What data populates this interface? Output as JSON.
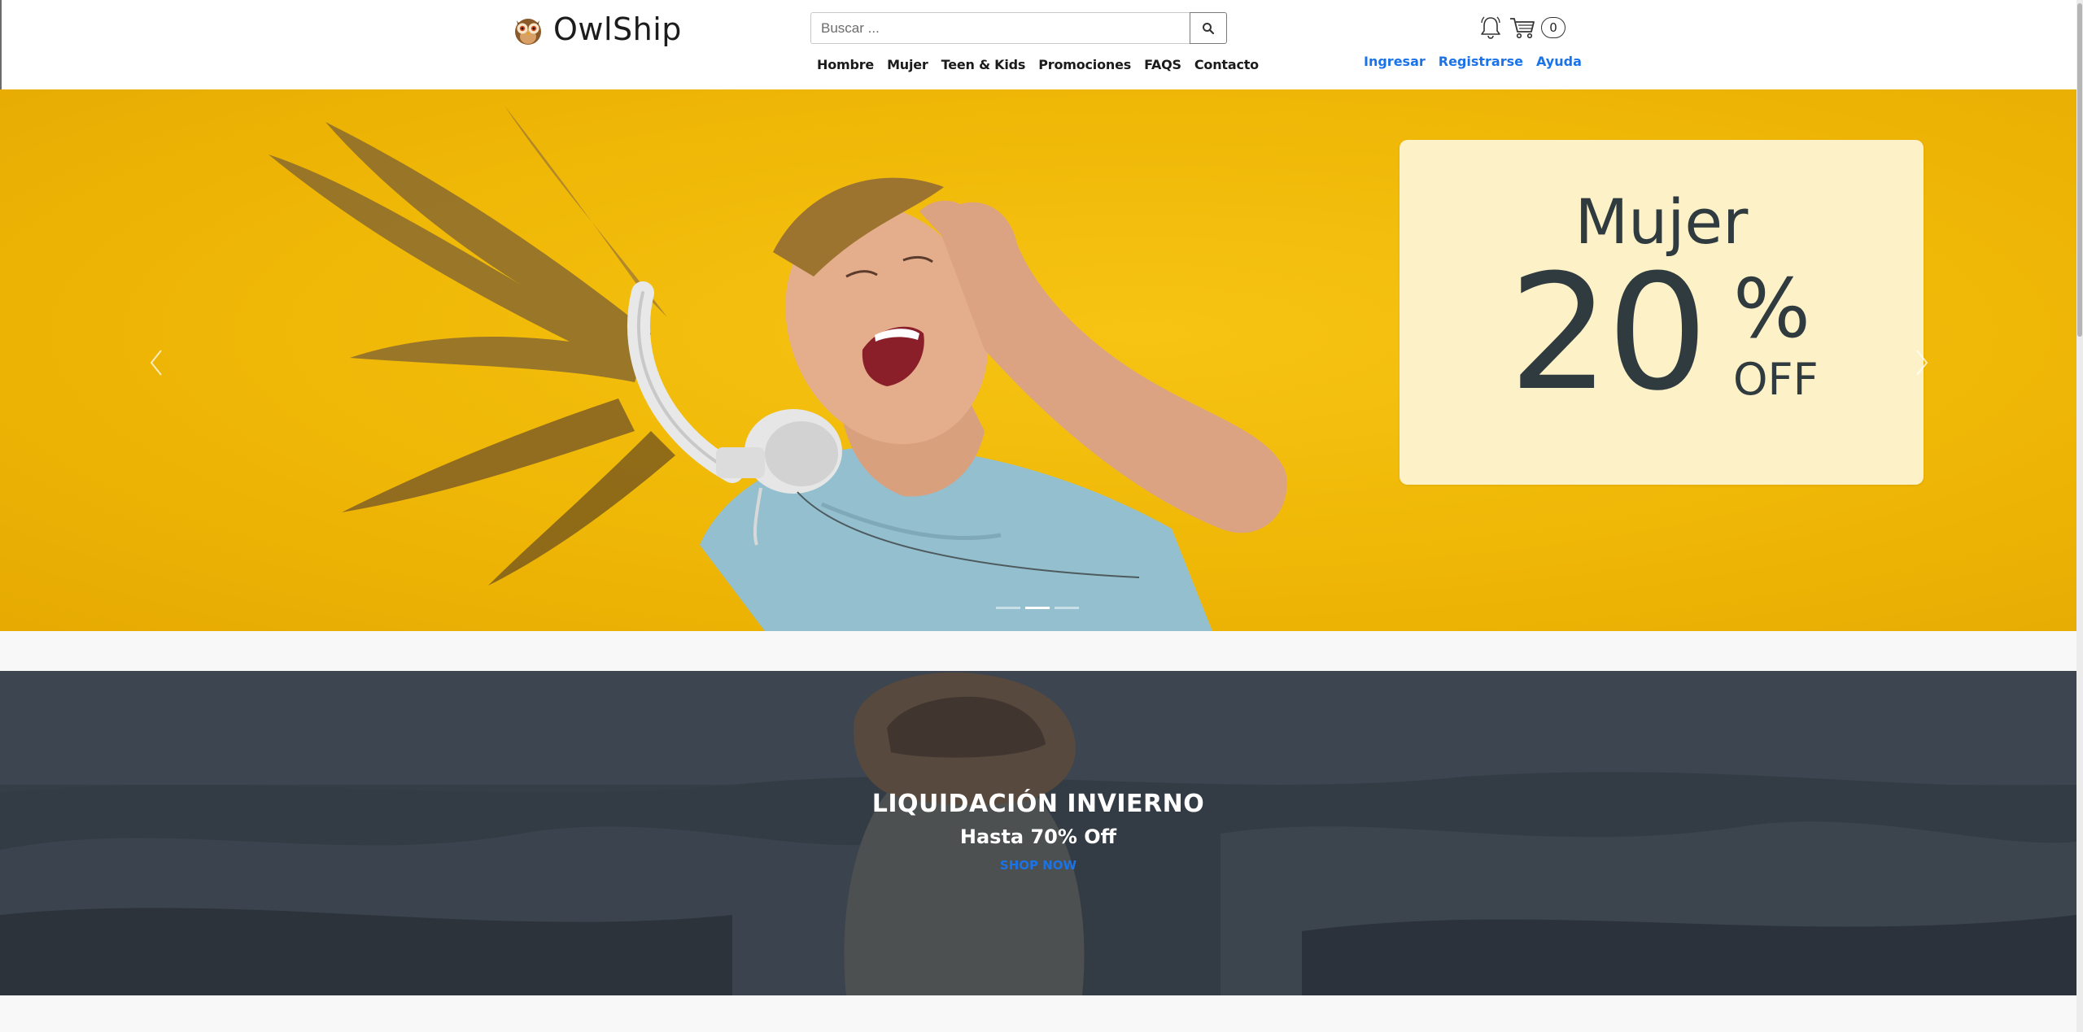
{
  "header": {
    "brand": "OwlShip",
    "search": {
      "placeholder": "Buscar ..."
    },
    "nav": [
      "Hombre",
      "Mujer",
      "Teen & Kids",
      "Promociones",
      "FAQS",
      "Contacto"
    ],
    "cart_count": "0",
    "account": [
      "Ingresar",
      "Registrarse",
      "Ayuda"
    ]
  },
  "hero": {
    "promo_title": "Mujer",
    "promo_number": "20",
    "promo_percent": "%",
    "promo_off": "OFF",
    "slide_count": 3,
    "active_slide": 1
  },
  "winter": {
    "title": "LIQUIDACIÓN INVIERNO",
    "subtitle": "Hasta 70% Off",
    "cta": "SHOP NOW"
  },
  "colors": {
    "link_blue": "#1a73e8",
    "hero_yellow": "#f0b808",
    "promo_card": "#fdf1c7",
    "promo_text": "#2f3b3f"
  },
  "icons": [
    "owl-logo-icon",
    "search-icon",
    "bell-icon",
    "cart-icon",
    "chevron-left-icon",
    "chevron-right-icon"
  ]
}
